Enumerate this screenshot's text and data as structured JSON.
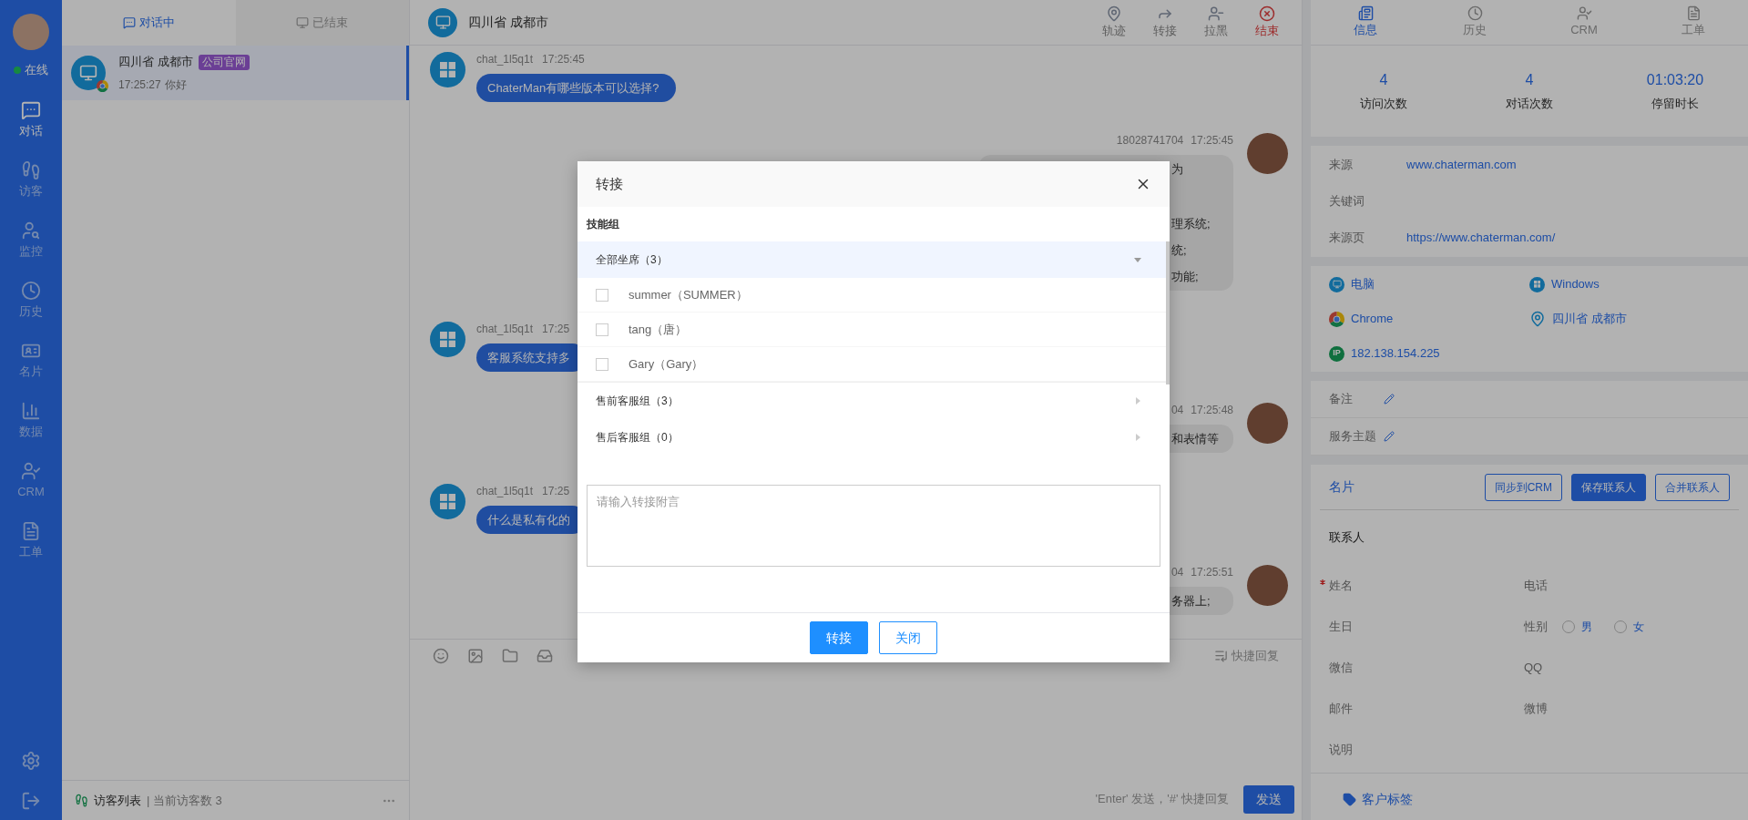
{
  "sidebar": {
    "status": "在线",
    "items": [
      {
        "label": "对话",
        "selected": true
      },
      {
        "label": "访客",
        "selected": false
      },
      {
        "label": "监控",
        "selected": false
      },
      {
        "label": "历史",
        "selected": false
      },
      {
        "label": "名片",
        "selected": false
      },
      {
        "label": "数据",
        "selected": false
      },
      {
        "label": "CRM",
        "selected": false
      },
      {
        "label": "工单",
        "selected": false
      }
    ]
  },
  "conversation_list": {
    "tabs": [
      {
        "label": "对话中",
        "selected": true
      },
      {
        "label": "已结束",
        "selected": false
      }
    ],
    "items": [
      {
        "location": "四川省 成都市",
        "tag": "公司官网",
        "time": "17:25:27",
        "preview": "你好",
        "selected": true
      }
    ],
    "footer": {
      "title": "访客列表",
      "count": "| 当前访客数 3"
    }
  },
  "chat": {
    "title": "四川省 成都市",
    "actions": [
      {
        "label": "轨迹",
        "kind": "normal"
      },
      {
        "label": "转接",
        "kind": "normal"
      },
      {
        "label": "拉黑",
        "kind": "normal"
      },
      {
        "label": "结束",
        "kind": "danger"
      }
    ],
    "messages": [
      {
        "kind": "visitor",
        "sender": "chat_1l5q1t",
        "time": "17:25:45",
        "lines": [
          "ChaterMan有哪些版本可以选择?"
        ]
      },
      {
        "kind": "agent",
        "sender": "18028741704",
        "time": "17:25:45",
        "lines": [
          "为",
          "理系统;",
          "统;",
          "功能;"
        ]
      },
      {
        "kind": "visitor",
        "sender": "chat_1l5q1t",
        "time": "17:25",
        "lines": [
          "客服系统支持多"
        ]
      },
      {
        "kind": "agent",
        "sender": "04",
        "time": "17:25:48",
        "lines": [
          "和表情等"
        ]
      },
      {
        "kind": "visitor",
        "sender": "chat_1l5q1t",
        "time": "17:25",
        "lines": [
          "什么是私有化的"
        ]
      },
      {
        "kind": "agent",
        "sender": "04",
        "time": "17:25:51",
        "lines": [
          "务器上;"
        ]
      }
    ],
    "quick_reply": "快捷回复",
    "hint": "'Enter' 发送，'#' 快捷回复",
    "send": "发送"
  },
  "dialog": {
    "title": "转接",
    "section": "技能组",
    "groups": [
      {
        "label": "全部坐席（3）",
        "expanded": true,
        "members": [
          {
            "label": "summer（SUMMER）",
            "checked": false
          },
          {
            "label": "tang（唐）",
            "checked": false
          },
          {
            "label": "Gary（Gary）",
            "checked": false
          }
        ]
      },
      {
        "label": "售前客服组（3）",
        "expanded": false
      },
      {
        "label": "售后客服组（0）",
        "expanded": false
      }
    ],
    "note": {
      "placeholder": "请输入转接附言"
    },
    "buttons": [
      {
        "label": "转接",
        "kind": "primary"
      },
      {
        "label": "关闭",
        "kind": "outline"
      }
    ]
  },
  "info_panel": {
    "tabs": [
      {
        "label": "信息",
        "selected": true
      },
      {
        "label": "历史",
        "selected": false
      },
      {
        "label": "CRM",
        "selected": false
      },
      {
        "label": "工单",
        "selected": false
      }
    ],
    "stats": [
      {
        "value": "4",
        "label": "访问次数"
      },
      {
        "value": "4",
        "label": "对话次数"
      },
      {
        "value": "01:03:20",
        "label": "停留时长"
      }
    ],
    "source": [
      {
        "label": "来源",
        "value": "www.chaterman.com"
      },
      {
        "label": "关键词"
      },
      {
        "label": "来源页",
        "value": "https://www.chaterman.com/"
      }
    ],
    "device": [
      {
        "text": "电脑"
      },
      {
        "text": "Windows"
      },
      {
        "text": "Chrome"
      },
      {
        "text": "四川省 成都市"
      },
      {
        "text": "182.138.154.225",
        "badge": "IP"
      }
    ],
    "notes": [
      {
        "label": "备注"
      },
      {
        "label": "服务主题"
      }
    ],
    "card": {
      "title": "名片",
      "buttons": [
        {
          "label": "同步到CRM",
          "kind": "outline"
        },
        {
          "label": "保存联系人",
          "kind": "primary"
        },
        {
          "label": "合并联系人",
          "kind": "outline"
        }
      ],
      "section": "联系人",
      "fields": [
        {
          "label": "姓名",
          "required": true
        },
        {
          "label": "电话",
          "required": false
        },
        {
          "label": "生日",
          "required": false
        },
        {
          "label": "性别",
          "required": false,
          "options": [
            {
              "label": "男",
              "selected": false
            },
            {
              "label": "女",
              "selected": false
            }
          ]
        },
        {
          "label": "微信",
          "required": false
        },
        {
          "label": "QQ",
          "required": false
        },
        {
          "label": "邮件",
          "required": false
        },
        {
          "label": "微博",
          "required": false
        },
        {
          "label": "说明",
          "required": false
        }
      ],
      "tag_link": "客户标签"
    }
  }
}
